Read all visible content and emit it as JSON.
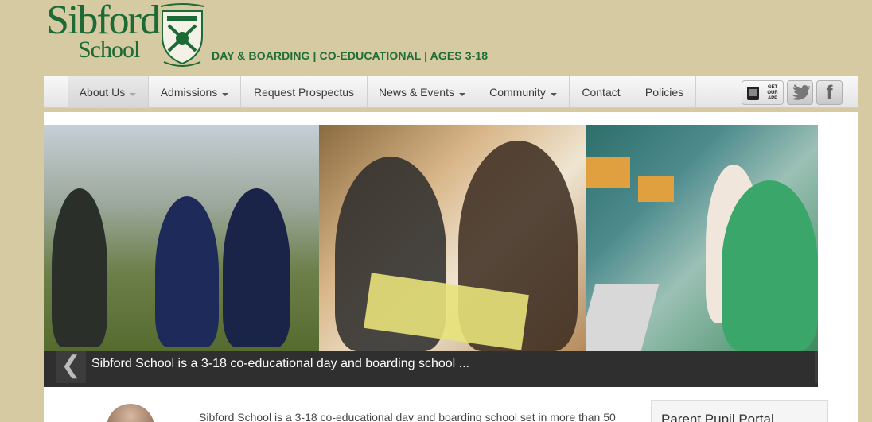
{
  "header": {
    "logo_line1": "Sibford",
    "logo_line2": "School",
    "tagline": "DAY & BOARDING | CO-EDUCATIONAL | AGES 3-18"
  },
  "nav": {
    "items": [
      {
        "label": "About Us",
        "has_dropdown": true
      },
      {
        "label": "Admissions",
        "has_dropdown": true
      },
      {
        "label": "Request Prospectus",
        "has_dropdown": false
      },
      {
        "label": "News & Events",
        "has_dropdown": true
      },
      {
        "label": "Community",
        "has_dropdown": true
      },
      {
        "label": "Contact",
        "has_dropdown": false
      },
      {
        "label": "Policies",
        "has_dropdown": false
      }
    ],
    "app_button": "GET OUR APP",
    "twitter_icon": "twitter-bird-icon",
    "facebook_icon": "f"
  },
  "slider": {
    "caption": "Sibford School is a 3-18 co-educational day and boarding school ...",
    "prev": "❮",
    "next": "❯"
  },
  "content": {
    "intro": "Sibford School is a 3-18 co-educational day and boarding school set in more than 50",
    "portal_title": "Parent Pupil Portal"
  },
  "colors": {
    "background": "#d6caa2",
    "brand_green": "#1f6e36",
    "caption_bar": "#2f2f2f"
  }
}
